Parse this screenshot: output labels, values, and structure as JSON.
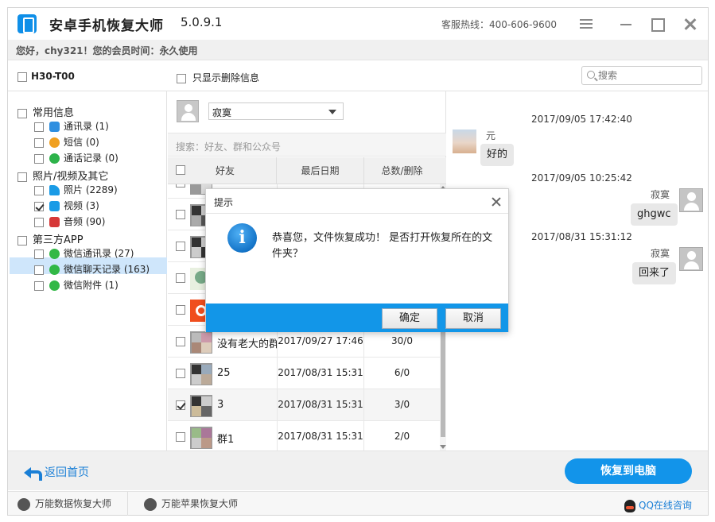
{
  "app": {
    "title": "安卓手机恢复大师",
    "version": "5.0.9.1",
    "hotline": "客服热线：400-606-9600",
    "user_info": "您好，chy321！您的会员时间：永久使用"
  },
  "toolbar": {
    "device": "H30-T00",
    "deleted_only_label": "只显示删除信息",
    "search_placeholder": "搜索"
  },
  "tree": {
    "groups": [
      {
        "label": "常用信息"
      },
      {
        "label": "照片/视频及其它"
      },
      {
        "label": "第三方APP"
      }
    ],
    "items": [
      {
        "label": "通讯录 (1)",
        "icon": "contacts-icon",
        "checked": false
      },
      {
        "label": "短信 (0)",
        "icon": "sms-icon",
        "checked": false
      },
      {
        "label": "通话记录 (0)",
        "icon": "call-log-icon",
        "checked": false
      },
      {
        "label": "照片 (2289)",
        "icon": "photo-icon",
        "checked": false
      },
      {
        "label": "视频 (3)",
        "icon": "video-icon",
        "checked": true
      },
      {
        "label": "音频 (90)",
        "icon": "audio-icon",
        "checked": false
      },
      {
        "label": "微信通讯录 (27)",
        "icon": "wechat-icon",
        "checked": false
      },
      {
        "label": "微信聊天记录 (163)",
        "icon": "wechat-icon",
        "checked": false,
        "selected": true
      },
      {
        "label": "微信附件 (1)",
        "icon": "wechat-icon",
        "checked": false
      }
    ]
  },
  "list": {
    "selected_contact": "寂寞",
    "search_placeholder": "搜索：好友、群和公众号",
    "columns": [
      "好友",
      "最后日期",
      "总数/删除"
    ],
    "rows": [
      {
        "name": "",
        "date": "",
        "count": "",
        "checked": false
      },
      {
        "name": "",
        "date": "",
        "count": "",
        "checked": false
      },
      {
        "name": "",
        "date": "",
        "count": "",
        "checked": false
      },
      {
        "name": "",
        "date": "",
        "count": "",
        "checked": false
      },
      {
        "name": "",
        "date": "",
        "count": "",
        "checked": false
      },
      {
        "name": "没有老大的群",
        "date": "2017/09/27 17:46",
        "count": "30/0",
        "checked": false
      },
      {
        "name": "25",
        "date": "2017/08/31 15:31",
        "count": "6/0",
        "checked": false
      },
      {
        "name": "3",
        "date": "2017/08/31 15:31",
        "count": "3/0",
        "checked": true
      },
      {
        "name": "群1",
        "date": "2017/08/31 15:31",
        "count": "2/0",
        "checked": false
      }
    ]
  },
  "chat": {
    "messages": [
      {
        "time": "2017/09/05 17:42:40",
        "sender": "元",
        "text": "好的",
        "side": "left"
      },
      {
        "time": "2017/09/05 10:25:42",
        "sender": "寂寞",
        "text": "ghgwc",
        "side": "right"
      },
      {
        "time": "2017/08/31 15:31:12",
        "sender": "寂寞",
        "text": "回来了",
        "side": "right"
      }
    ]
  },
  "bottom": {
    "back_label": "返回首页",
    "restore_label": "恢复到电脑"
  },
  "footer": {
    "link1": "万能数据恢复大师",
    "link2": "万能苹果恢复大师",
    "qq": "QQ在线咨询"
  },
  "dialog": {
    "title": "提示",
    "message": "恭喜您，文件恢复成功！ 是否打开恢复所在的文件夹？",
    "ok_label": "确定",
    "cancel_label": "取消"
  },
  "colors": {
    "accent": "#1294ea",
    "selected_row": "#cfe6fb"
  }
}
